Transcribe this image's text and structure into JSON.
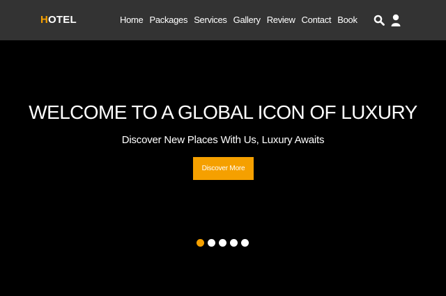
{
  "header": {
    "logo_first": "H",
    "logo_rest": "OTEL",
    "nav": [
      "Home",
      "Packages",
      "Services",
      "Gallery",
      "Review",
      "Contact",
      "Book"
    ],
    "icons": [
      "search-icon",
      "user-icon"
    ]
  },
  "hero": {
    "title": "WELCOME TO A GLOBAL ICON OF LUXURY",
    "subtitle": "Discover New Places With Us, Luxury Awaits",
    "cta_label": "Discover More"
  },
  "slider": {
    "total_slides": 5,
    "active_index": 0
  },
  "colors": {
    "accent": "#f5a000",
    "navbar_bg": "#333333",
    "hero_bg": "#000000",
    "text": "#ffffff"
  }
}
